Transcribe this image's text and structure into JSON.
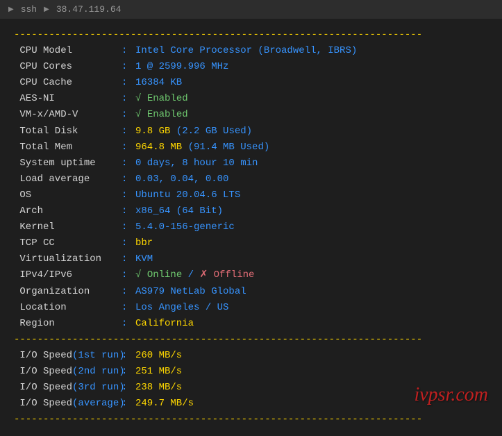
{
  "titlebar": {
    "prefix": "▶",
    "ssh": "ssh",
    "sep": "▶",
    "host": "38.47.119.64"
  },
  "divider": "----------------------------------------------------------------------",
  "rows": [
    {
      "label": " CPU Model",
      "value": "Intel Core Processor (Broadwell, IBRS)",
      "style": "value"
    },
    {
      "label": " CPU Cores",
      "value": "1 @ 2599.996 MHz",
      "style": "value"
    },
    {
      "label": " CPU Cache",
      "value": "16384 KB",
      "style": "value"
    },
    {
      "label": " AES-NI",
      "check": true,
      "checktext": "Enabled"
    },
    {
      "label": " VM-x/AMD-V",
      "check": true,
      "checktext": "Enabled"
    },
    {
      "label": " Total Disk",
      "value": "9.8 GB",
      "style": "yellow",
      "extra": "(2.2 GB Used)",
      "extrastyle": "value"
    },
    {
      "label": " Total Mem",
      "value": "964.8 MB",
      "style": "yellow",
      "extra": "(91.4 MB Used)",
      "extrastyle": "value"
    },
    {
      "label": " System uptime",
      "value": "0 days, 8 hour 10 min",
      "style": "value"
    },
    {
      "label": " Load average",
      "value": "0.03, 0.04, 0.00",
      "style": "value"
    },
    {
      "label": " OS",
      "value": "Ubuntu 20.04.6 LTS",
      "style": "value"
    },
    {
      "label": " Arch",
      "value": "x86_64 (64 Bit)",
      "style": "value"
    },
    {
      "label": " Kernel",
      "value": "5.4.0-156-generic",
      "style": "value"
    },
    {
      "label": " TCP CC",
      "value": "bbr",
      "style": "yellow"
    },
    {
      "label": " Virtualization",
      "value": "KVM",
      "style": "value"
    },
    {
      "label": " IPv4/IPv6",
      "ipv4": "Online",
      "ipv6": "Offline"
    },
    {
      "label": " Organization",
      "value": "AS979 NetLab Global",
      "style": "value"
    },
    {
      "label": " Location",
      "value": "Los Angeles / US",
      "style": "value"
    },
    {
      "label": " Region",
      "value": "California",
      "style": "yellow"
    }
  ],
  "io_rows": [
    {
      "label": " I/O Speed",
      "paren": "(1st run)",
      "value": "260 MB/s"
    },
    {
      "label": " I/O Speed",
      "paren": "(2nd run)",
      "value": "251 MB/s"
    },
    {
      "label": " I/O Speed",
      "paren": "(3rd run)",
      "value": "238 MB/s"
    },
    {
      "label": " I/O Speed",
      "paren": "(average)",
      "value": "249.7 MB/s"
    }
  ],
  "watermark": "ivpsr.com",
  "symbols": {
    "check": "√",
    "cross": "✗",
    "slash": " / "
  }
}
